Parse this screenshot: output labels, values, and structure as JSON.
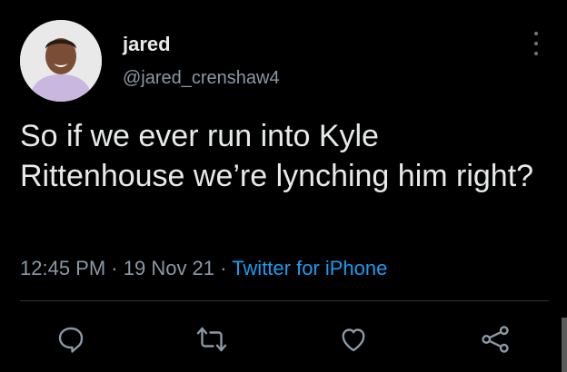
{
  "tweet": {
    "display_name": "jared",
    "handle": "@jared_crenshaw4",
    "text": "So if we ever run into Kyle Rittenhouse we’re lynching him right?",
    "time": "12:45 PM",
    "separator": " · ",
    "date": "19 Nov 21",
    "source": "Twitter for iPhone"
  },
  "icons": {
    "more": "more-options-icon",
    "reply": "reply-icon",
    "retweet": "retweet-icon",
    "like": "like-icon",
    "share": "share-icon"
  },
  "colors": {
    "background": "#000000",
    "text": "#e7e9ea",
    "secondary": "#8b98a5",
    "link": "#1d9bf0",
    "icon": "#8b98a5"
  }
}
